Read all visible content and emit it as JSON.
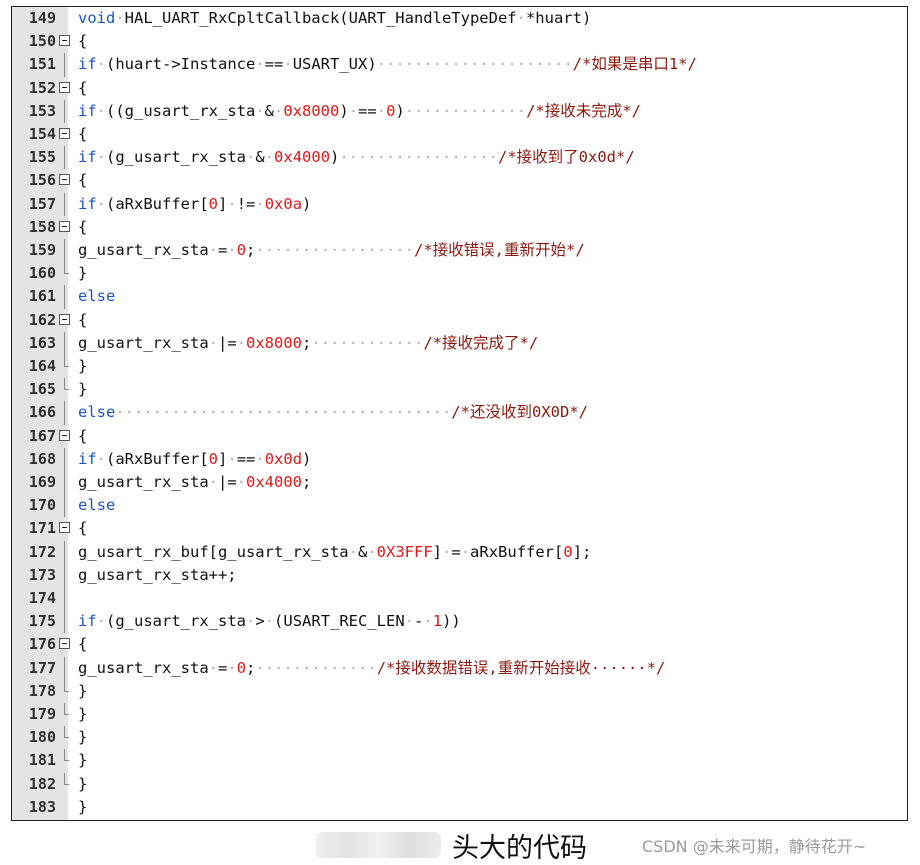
{
  "lines": [
    {
      "n": "149",
      "fold": "none",
      "tokens": [
        [
          "kw",
          "void"
        ],
        [
          "dot",
          "·"
        ],
        [
          "t",
          "HAL_UART_RxCpltCallback(UART_HandleTypeDef"
        ],
        [
          "dot",
          "·"
        ],
        [
          "t",
          "*huart)"
        ]
      ]
    },
    {
      "n": "150",
      "fold": "open",
      "tokens": [
        [
          "t",
          "{"
        ]
      ]
    },
    {
      "n": "151",
      "fold": "line",
      "tokens": [
        [
          "kw",
          "if"
        ],
        [
          "dot",
          "·"
        ],
        [
          "t",
          "(huart->Instance"
        ],
        [
          "dot",
          "·"
        ],
        [
          "t",
          "=="
        ],
        [
          "dot",
          "·"
        ],
        [
          "t",
          "USART_UX)"
        ],
        [
          "dot",
          "·····················"
        ],
        [
          "cm",
          "/*如果是串口1*/"
        ]
      ]
    },
    {
      "n": "152",
      "fold": "open",
      "tokens": [
        [
          "t",
          "{"
        ]
      ]
    },
    {
      "n": "153",
      "fold": "line",
      "tokens": [
        [
          "kw",
          "if"
        ],
        [
          "dot",
          "·"
        ],
        [
          "t",
          "((g_usart_rx_sta"
        ],
        [
          "dot",
          "·"
        ],
        [
          "t",
          "&"
        ],
        [
          "dot",
          "·"
        ],
        [
          "num",
          "0x8000"
        ],
        [
          "t",
          ")"
        ],
        [
          "dot",
          "·"
        ],
        [
          "t",
          "=="
        ],
        [
          "dot",
          "·"
        ],
        [
          "num",
          "0"
        ],
        [
          "t",
          ")"
        ],
        [
          "dot",
          "·············"
        ],
        [
          "cm",
          "/*接收未完成*/"
        ]
      ]
    },
    {
      "n": "154",
      "fold": "open",
      "tokens": [
        [
          "t",
          "{"
        ]
      ]
    },
    {
      "n": "155",
      "fold": "line",
      "tokens": [
        [
          "kw",
          "if"
        ],
        [
          "dot",
          "·"
        ],
        [
          "t",
          "(g_usart_rx_sta"
        ],
        [
          "dot",
          "·"
        ],
        [
          "t",
          "&"
        ],
        [
          "dot",
          "·"
        ],
        [
          "num",
          "0x4000"
        ],
        [
          "t",
          ")"
        ],
        [
          "dot",
          "·················"
        ],
        [
          "cm",
          "/*接收到了0x0d*/"
        ]
      ]
    },
    {
      "n": "156",
      "fold": "open",
      "tokens": [
        [
          "t",
          "{"
        ]
      ]
    },
    {
      "n": "157",
      "fold": "line",
      "tokens": [
        [
          "kw",
          "if"
        ],
        [
          "dot",
          "·"
        ],
        [
          "t",
          "(aRxBuffer["
        ],
        [
          "num",
          "0"
        ],
        [
          "t",
          "]"
        ],
        [
          "dot",
          "·"
        ],
        [
          "t",
          "!="
        ],
        [
          "dot",
          "·"
        ],
        [
          "num",
          "0x0a"
        ],
        [
          "t",
          ")"
        ]
      ]
    },
    {
      "n": "158",
      "fold": "open",
      "tokens": [
        [
          "t",
          "{"
        ]
      ]
    },
    {
      "n": "159",
      "fold": "line",
      "tokens": [
        [
          "t",
          "g_usart_rx_sta"
        ],
        [
          "dot",
          "·"
        ],
        [
          "t",
          "="
        ],
        [
          "dot",
          "·"
        ],
        [
          "num",
          "0"
        ],
        [
          "t",
          ";"
        ],
        [
          "dot",
          "·················"
        ],
        [
          "cm",
          "/*接收错误,重新开始*/"
        ]
      ]
    },
    {
      "n": "160",
      "fold": "end",
      "tokens": [
        [
          "t",
          "}"
        ]
      ]
    },
    {
      "n": "161",
      "fold": "line",
      "tokens": [
        [
          "kw",
          "else"
        ]
      ]
    },
    {
      "n": "162",
      "fold": "open",
      "tokens": [
        [
          "t",
          "{"
        ]
      ]
    },
    {
      "n": "163",
      "fold": "line",
      "tokens": [
        [
          "t",
          "g_usart_rx_sta"
        ],
        [
          "dot",
          "·"
        ],
        [
          "t",
          "|="
        ],
        [
          "dot",
          "·"
        ],
        [
          "num",
          "0x8000"
        ],
        [
          "t",
          ";"
        ],
        [
          "dot",
          "············"
        ],
        [
          "cm",
          "/*接收完成了*/"
        ]
      ]
    },
    {
      "n": "164",
      "fold": "end",
      "tokens": [
        [
          "t",
          "}"
        ]
      ]
    },
    {
      "n": "165",
      "fold": "end",
      "tokens": [
        [
          "t",
          "}"
        ]
      ]
    },
    {
      "n": "166",
      "fold": "line",
      "tokens": [
        [
          "kw",
          "else"
        ],
        [
          "dot",
          "····································"
        ],
        [
          "cm",
          "/*还没收到0X0D*/"
        ]
      ]
    },
    {
      "n": "167",
      "fold": "open",
      "tokens": [
        [
          "t",
          "{"
        ]
      ]
    },
    {
      "n": "168",
      "fold": "line",
      "tokens": [
        [
          "kw",
          "if"
        ],
        [
          "dot",
          "·"
        ],
        [
          "t",
          "(aRxBuffer["
        ],
        [
          "num",
          "0"
        ],
        [
          "t",
          "]"
        ],
        [
          "dot",
          "·"
        ],
        [
          "t",
          "=="
        ],
        [
          "dot",
          "·"
        ],
        [
          "num",
          "0x0d"
        ],
        [
          "t",
          ")"
        ]
      ]
    },
    {
      "n": "169",
      "fold": "line",
      "tokens": [
        [
          "t",
          "g_usart_rx_sta"
        ],
        [
          "dot",
          "·"
        ],
        [
          "t",
          "|="
        ],
        [
          "dot",
          "·"
        ],
        [
          "num",
          "0x4000"
        ],
        [
          "t",
          ";"
        ]
      ]
    },
    {
      "n": "170",
      "fold": "line",
      "tokens": [
        [
          "kw",
          "else"
        ]
      ]
    },
    {
      "n": "171",
      "fold": "open",
      "tokens": [
        [
          "t",
          "{"
        ]
      ]
    },
    {
      "n": "172",
      "fold": "line",
      "tokens": [
        [
          "t",
          "g_usart_rx_buf[g_usart_rx_sta"
        ],
        [
          "dot",
          "·"
        ],
        [
          "t",
          "&"
        ],
        [
          "dot",
          "·"
        ],
        [
          "num",
          "0X3FFF"
        ],
        [
          "t",
          "]"
        ],
        [
          "dot",
          "·"
        ],
        [
          "t",
          "="
        ],
        [
          "dot",
          "·"
        ],
        [
          "t",
          "aRxBuffer["
        ],
        [
          "num",
          "0"
        ],
        [
          "t",
          "];"
        ]
      ]
    },
    {
      "n": "173",
      "fold": "line",
      "tokens": [
        [
          "t",
          "g_usart_rx_sta++;"
        ]
      ]
    },
    {
      "n": "174",
      "fold": "line",
      "tokens": []
    },
    {
      "n": "175",
      "fold": "line",
      "tokens": [
        [
          "kw",
          "if"
        ],
        [
          "dot",
          "·"
        ],
        [
          "t",
          "(g_usart_rx_sta"
        ],
        [
          "dot",
          "·"
        ],
        [
          "t",
          ">"
        ],
        [
          "dot",
          "·"
        ],
        [
          "t",
          "(USART_REC_LEN"
        ],
        [
          "dot",
          "·"
        ],
        [
          "t",
          "-"
        ],
        [
          "dot",
          "·"
        ],
        [
          "num",
          "1"
        ],
        [
          "t",
          "))"
        ]
      ]
    },
    {
      "n": "176",
      "fold": "open",
      "tokens": [
        [
          "t",
          "{"
        ]
      ]
    },
    {
      "n": "177",
      "fold": "line",
      "tokens": [
        [
          "t",
          "g_usart_rx_sta"
        ],
        [
          "dot",
          "·"
        ],
        [
          "t",
          "="
        ],
        [
          "dot",
          "·"
        ],
        [
          "num",
          "0"
        ],
        [
          "t",
          ";"
        ],
        [
          "dot",
          "·············"
        ],
        [
          "cm",
          "/*接收数据错误,重新开始接收······*/"
        ]
      ]
    },
    {
      "n": "178",
      "fold": "end",
      "tokens": [
        [
          "t",
          "}"
        ]
      ]
    },
    {
      "n": "179",
      "fold": "end",
      "tokens": [
        [
          "t",
          "}"
        ]
      ]
    },
    {
      "n": "180",
      "fold": "end",
      "tokens": [
        [
          "t",
          "}"
        ]
      ]
    },
    {
      "n": "181",
      "fold": "end",
      "tokens": [
        [
          "t",
          "}"
        ]
      ]
    },
    {
      "n": "182",
      "fold": "end",
      "tokens": [
        [
          "t",
          "}"
        ]
      ]
    },
    {
      "n": "183",
      "fold": "none",
      "tokens": [
        [
          "t",
          "}"
        ]
      ]
    }
  ],
  "caption": "头大的代码",
  "watermark": "CSDN @未来可期，静待花开~"
}
